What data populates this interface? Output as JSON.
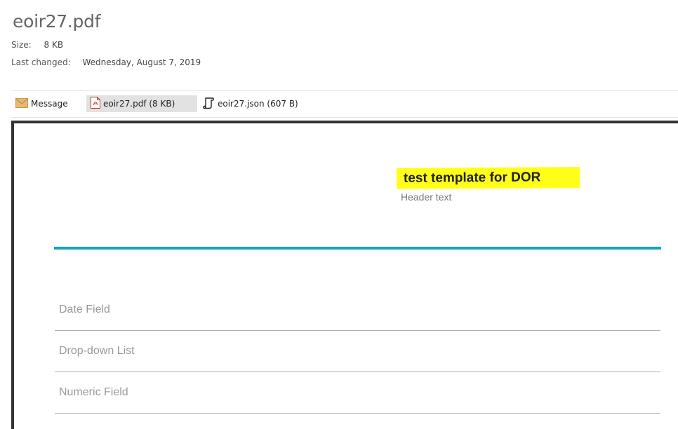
{
  "file": {
    "name": "eoir27.pdf",
    "size_label": "Size:",
    "size_value": "8 KB",
    "changed_label": "Last changed:",
    "changed_value": "Wednesday, August 7, 2019"
  },
  "attachments": [
    {
      "label": "Message",
      "icon": "envelope-icon"
    },
    {
      "label": "eoir27.pdf (8 KB)",
      "icon": "pdf-icon",
      "selected": true
    },
    {
      "label": "eoir27.json (607 B)",
      "icon": "json-script-icon"
    }
  ],
  "preview": {
    "title": "test template for DOR",
    "subtitle": "Header text",
    "accent_color": "#14a4c0",
    "highlight_color": "#ffff1a",
    "fields": [
      "Date Field",
      "Drop-down List",
      "Numeric Field"
    ]
  }
}
